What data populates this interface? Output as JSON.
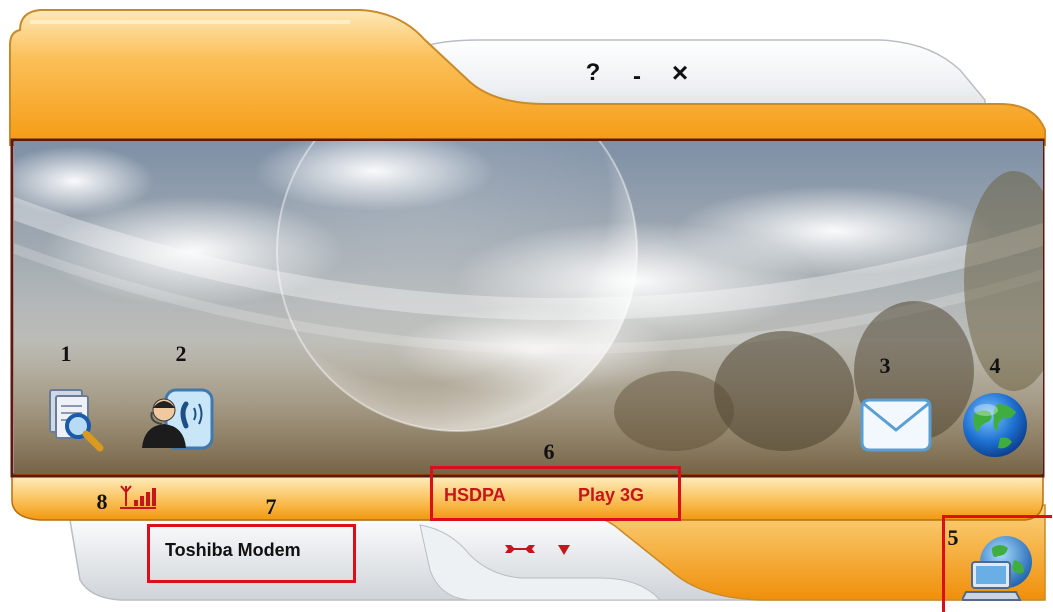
{
  "window": {
    "help_label": "?",
    "minimize_label": "-",
    "close_label": "×"
  },
  "callouts": [
    "1",
    "2",
    "3",
    "4",
    "5",
    "6",
    "7",
    "8"
  ],
  "toolbar": {
    "icons": [
      "search-document-icon",
      "contact-phone-icon",
      "envelope-icon",
      "globe-icon"
    ]
  },
  "status": {
    "network_type": "HSDPA",
    "operator": "Play 3G",
    "device_name": "Toshiba Modem",
    "signal_icon": "signal-strength-icon",
    "settings_icon": "wrench-icon",
    "dropdown_icon": "chevron-down-icon",
    "connect_icon": "network-computer-icon"
  },
  "colors": {
    "accent_orange": "#f6a623",
    "frame_dark": "#5a1a12",
    "highlight_red": "#d90f1c",
    "status_text_red": "#c4161c"
  }
}
